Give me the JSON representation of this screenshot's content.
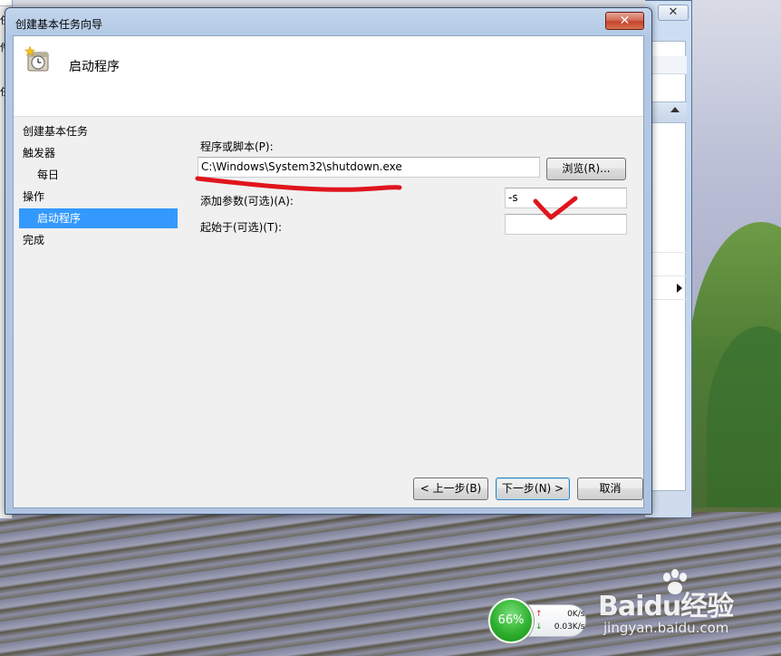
{
  "dialog": {
    "title": "创建基本任务向导",
    "header_title": "启动程序"
  },
  "steps": {
    "heading": "创建基本任务",
    "items": [
      {
        "label": "触发器"
      },
      {
        "label": "每日"
      },
      {
        "label": "操作"
      },
      {
        "label": "启动程序"
      },
      {
        "label": "完成"
      }
    ]
  },
  "form": {
    "program_label": "程序或脚本(P):",
    "program_value": "C:\\Windows\\System32\\shutdown.exe",
    "browse_label": "浏览(R)...",
    "args_label": "添加参数(可选)(A):",
    "args_value": "-s",
    "start_label": "起始于(可选)(T):",
    "start_value": ""
  },
  "buttons": {
    "back": "< 上一步(B)",
    "next": "下一步(N) >",
    "cancel": "取消"
  },
  "background": {
    "left_window_fragments": [
      "任",
      "件(",
      "任"
    ],
    "right_window_close": "✕"
  },
  "net_monitor": {
    "percent": "66%",
    "upload": "0K/s",
    "download": "0.03K/s"
  },
  "watermark": {
    "brand": "Baidu经验",
    "url": "jingyan.baidu.com"
  },
  "colors": {
    "selection": "#3399ff",
    "annotation_red": "#e0141c",
    "close_red": "#c5432b"
  }
}
